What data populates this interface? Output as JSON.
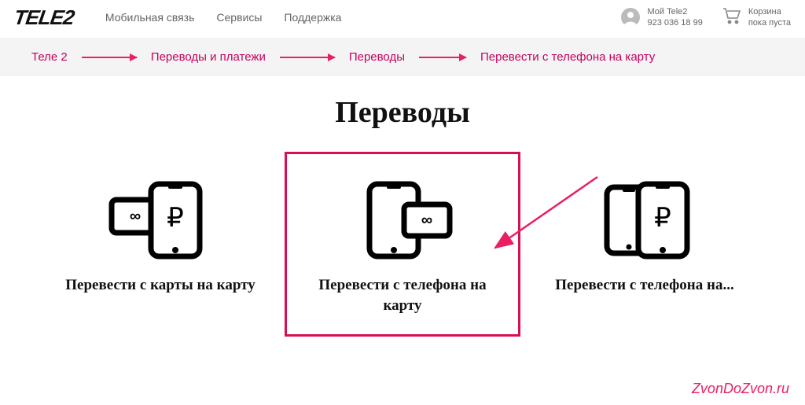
{
  "header": {
    "logo": "TELE2",
    "nav": [
      "Мобильная связь",
      "Сервисы",
      "Поддержка"
    ],
    "account": {
      "label": "Мой Tele2",
      "phone": "923 036 18 99"
    },
    "cart": {
      "label": "Корзина",
      "status": "пока пуста"
    }
  },
  "breadcrumb": [
    "Теле 2",
    "Переводы и платежи",
    "Переводы",
    "Перевести с телефона на карту"
  ],
  "title": "Переводы",
  "cards": [
    {
      "label": "Перевести с карты на карту"
    },
    {
      "label": "Перевести с телефона на карту"
    },
    {
      "label": "Перевести с телефона на..."
    }
  ],
  "watermark": "ZvonDoZvon.ru"
}
